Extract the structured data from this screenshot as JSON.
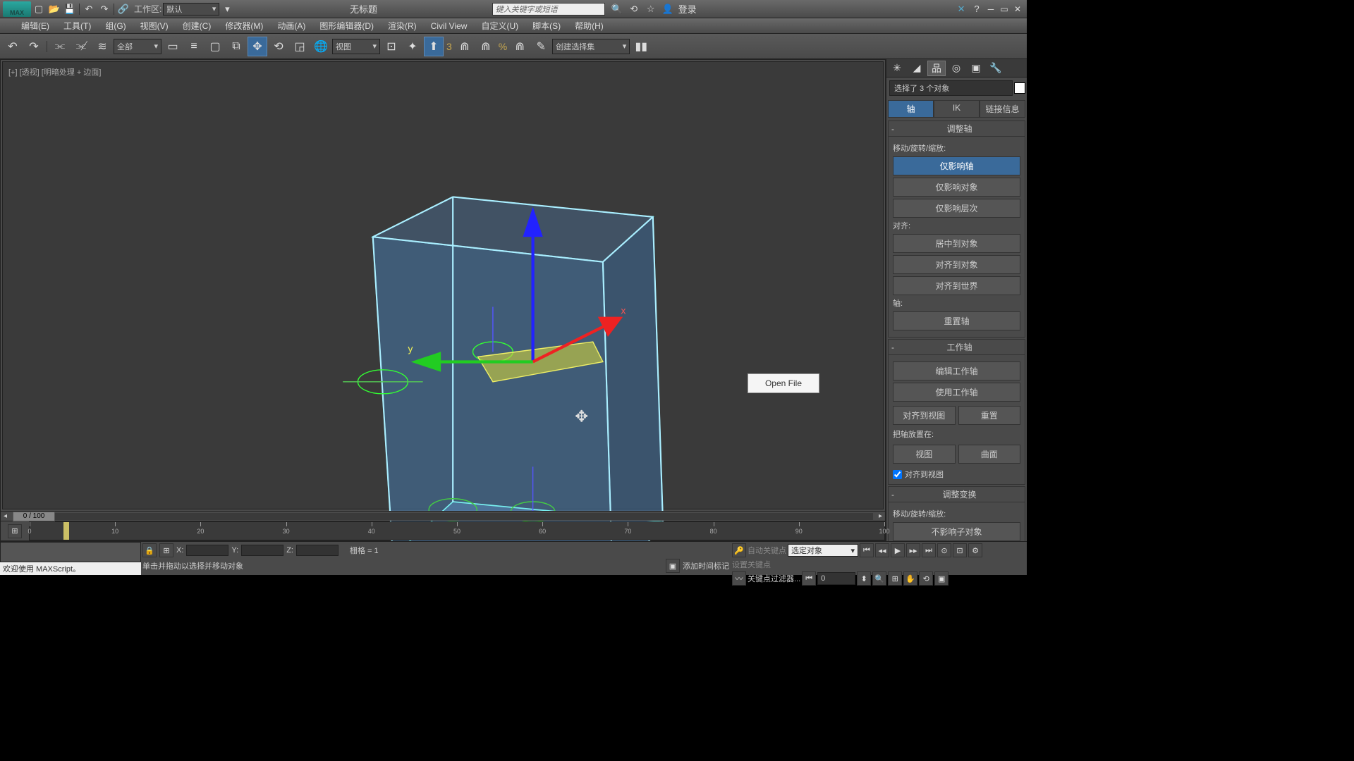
{
  "titlebar": {
    "logo_text": "MAX",
    "workspace_label": "工作区:",
    "workspace_value": "默认",
    "title": "无标题",
    "search_placeholder": "键入关键字或短语",
    "login": "登录"
  },
  "menubar": [
    "编辑(E)",
    "工具(T)",
    "组(G)",
    "视图(V)",
    "创建(C)",
    "修改器(M)",
    "动画(A)",
    "图形编辑器(D)",
    "渲染(R)",
    "Civil View",
    "自定义(U)",
    "脚本(S)",
    "帮助(H)"
  ],
  "toolbar": {
    "filter_dd": "全部",
    "ref_dd": "视图",
    "angle_value": "3",
    "pct_value": "%",
    "named_set": "创建选择集"
  },
  "viewport": {
    "label": "[+] [透视] [明暗处理 + 边面]",
    "open_file": "Open File"
  },
  "sidepanel": {
    "selection_info": "选择了 3 个对象",
    "subtabs": [
      "轴",
      "IK",
      "链接信息"
    ],
    "rollout1": {
      "title": "调整轴",
      "group1_label": "移动/旋转/缩放:",
      "btn_pivot_only": "仅影响轴",
      "btn_obj_only": "仅影响对象",
      "btn_hier_only": "仅影响层次",
      "group2_label": "对齐:",
      "btn_center": "居中到对象",
      "btn_align_obj": "对齐到对象",
      "btn_align_world": "对齐到世界",
      "group3_label": "轴:",
      "btn_reset": "重置轴"
    },
    "rollout2": {
      "title": "工作轴",
      "btn_edit": "编辑工作轴",
      "btn_use": "使用工作轴",
      "btn_align_view": "对齐到视图",
      "btn_reset": "重置",
      "group_label": "把轴放置在:",
      "btn_view": "视图",
      "btn_surface": "曲面",
      "chk_align_view": "对齐到视图"
    },
    "rollout3": {
      "title": "调整变换",
      "group_label": "移动/旋转/缩放:",
      "btn_noaffect": "不影响子对象"
    }
  },
  "timeline": {
    "frame_display": "0 / 100",
    "ticks": [
      0,
      10,
      20,
      30,
      40,
      50,
      60,
      70,
      80,
      90,
      100
    ]
  },
  "status": {
    "script_welcome": "欢迎使用 MAXScript。",
    "prompt": "单击并拖动以选择并移动对象",
    "add_time_tag": "添加时间标记",
    "coord_x": "X:",
    "coord_y": "Y:",
    "coord_z": "Z:",
    "grid": "栅格 = 1",
    "auto_key": "自动关键点",
    "set_key": "设置关键点",
    "key_filter_dd": "选定对象",
    "key_filter_btn": "关键点过滤器...",
    "frame_value": "0"
  }
}
